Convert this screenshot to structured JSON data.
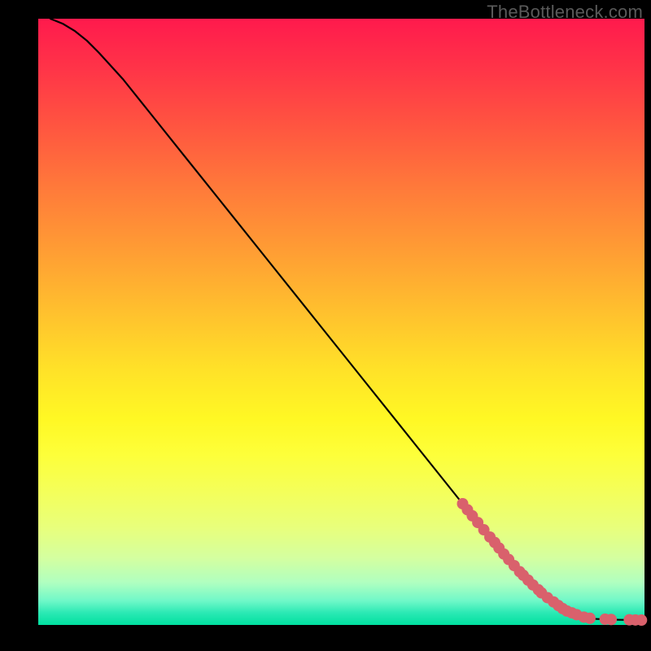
{
  "watermark": "TheBottleneck.com",
  "chart_data": {
    "type": "line",
    "title": "",
    "xlabel": "",
    "ylabel": "",
    "xlim": [
      0,
      100
    ],
    "ylim": [
      0,
      100
    ],
    "grid": false,
    "legend": false,
    "series": [
      {
        "name": "curve",
        "style": "line",
        "color": "#000000",
        "x": [
          2,
          4,
          6,
          8,
          10,
          14,
          18,
          24,
          30,
          38,
          46,
          54,
          62,
          70,
          76,
          80,
          84,
          86,
          88,
          90,
          92,
          94,
          96,
          98,
          99.5
        ],
        "y": [
          100,
          99.2,
          98.0,
          96.4,
          94.4,
          90.0,
          85.0,
          77.5,
          70.0,
          60.0,
          50.0,
          40.0,
          30.0,
          20.0,
          12.5,
          8.0,
          4.5,
          3.0,
          2.0,
          1.3,
          1.0,
          0.9,
          0.85,
          0.82,
          0.8
        ]
      },
      {
        "name": "points",
        "style": "scatter",
        "color": "#d9616c",
        "x": [
          70.0,
          70.8,
          71.6,
          72.5,
          73.5,
          74.5,
          75.3,
          76.0,
          76.8,
          77.6,
          78.5,
          79.4,
          80.0,
          80.8,
          81.6,
          82.5,
          83.0,
          84.0,
          85.0,
          85.8,
          86.5,
          87.2,
          88.0,
          88.8,
          90.0,
          91.0,
          93.5,
          94.5,
          97.5,
          98.5,
          99.5
        ],
        "y": [
          20.0,
          19.0,
          18.0,
          16.9,
          15.7,
          14.5,
          13.6,
          12.7,
          11.7,
          10.8,
          9.8,
          8.8,
          8.2,
          7.4,
          6.6,
          5.8,
          5.3,
          4.5,
          3.8,
          3.2,
          2.7,
          2.3,
          2.0,
          1.7,
          1.3,
          1.1,
          0.95,
          0.9,
          0.85,
          0.83,
          0.8
        ]
      }
    ]
  }
}
